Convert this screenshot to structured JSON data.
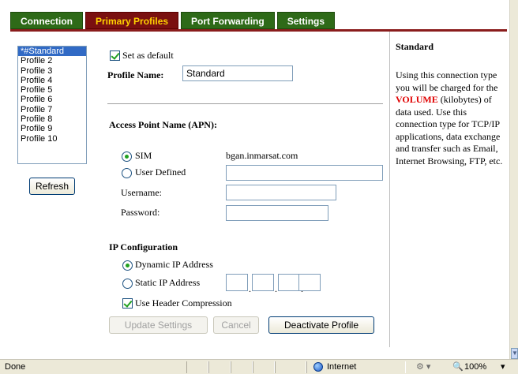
{
  "tabs": [
    {
      "label": "Connection",
      "active": false
    },
    {
      "label": "Primary Profiles",
      "active": true
    },
    {
      "label": "Port Forwarding",
      "active": false
    },
    {
      "label": "Settings",
      "active": false
    }
  ],
  "profiles": {
    "items": [
      "*#Standard",
      "Profile 2",
      "Profile 3",
      "Profile 4",
      "Profile 5",
      "Profile 6",
      "Profile 7",
      "Profile 8",
      "Profile 9",
      "Profile 10"
    ],
    "selected_index": 0,
    "refresh_label": "Refresh"
  },
  "form": {
    "set_default_label": "Set as default",
    "set_default_checked": true,
    "profile_name_label": "Profile Name:",
    "profile_name_value": "Standard",
    "apn_heading": "Access Point Name (APN):",
    "apn_sim_label": "SIM",
    "apn_sim_value": "bgan.inmarsat.com",
    "apn_user_defined_label": "User Defined",
    "apn_selected": "SIM",
    "username_label": "Username:",
    "password_label": "Password:",
    "ip_heading": "IP Configuration",
    "ip_dynamic_label": "Dynamic IP Address",
    "ip_static_label": "Static IP Address",
    "ip_selected": "Dynamic IP Address",
    "header_compression_label": "Use Header Compression",
    "header_compression_checked": true
  },
  "buttons": {
    "update_label": "Update Settings",
    "cancel_label": "Cancel",
    "deactivate_label": "Deactivate Profile"
  },
  "info": {
    "title": "Standard",
    "text_before": "Using this connection type you will be charged for the ",
    "highlight": "VOLUME",
    "text_after": " (kilobytes) of data used. Use this connection type for TCP/IP applications, data exchange and transfer such as Email, Internet Browsing, FTP, etc."
  },
  "statusbar": {
    "left_text": "Done",
    "zone_text": "Internet",
    "zoom_text": "100%"
  },
  "colors": {
    "tab_bg": "#2e6a18",
    "tab_active_bg": "#7a1010",
    "tab_active_text": "#ffd200",
    "accent": "#8a1c1c",
    "highlight_text": "#e00000",
    "selection": "#316ac5"
  }
}
